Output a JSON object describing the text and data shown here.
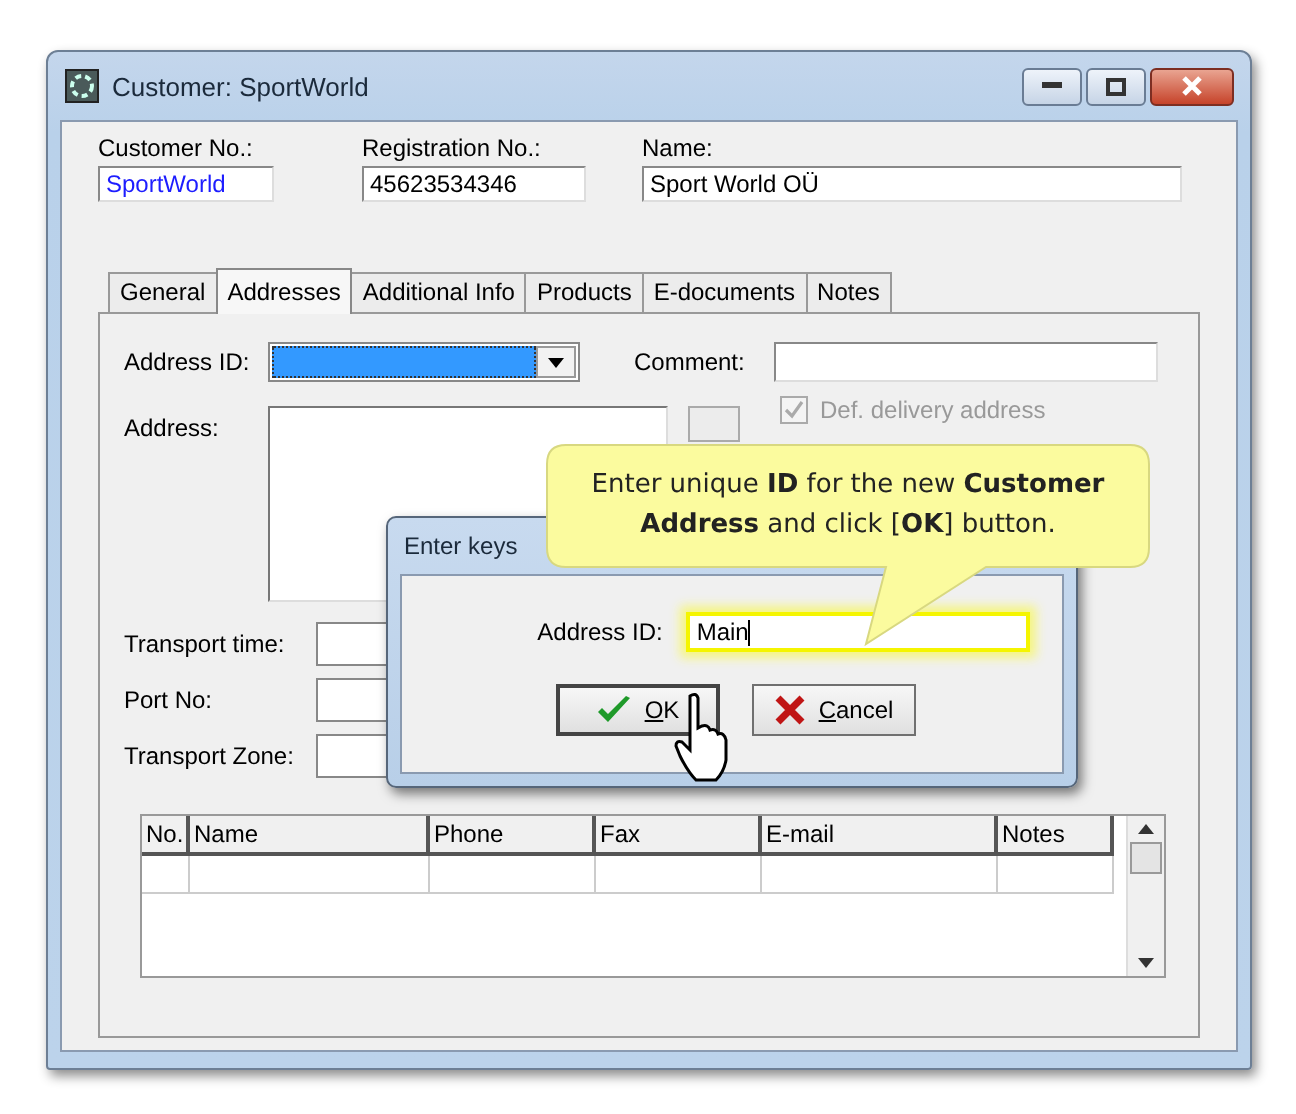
{
  "window": {
    "title": "Customer: SportWorld"
  },
  "header_fields": [
    {
      "label": "Customer No.:",
      "value": "SportWorld",
      "kind": "code"
    },
    {
      "label": "Registration No.:",
      "value": "45623534346",
      "kind": "text"
    },
    {
      "label": "Name:",
      "value": "Sport World OÜ",
      "kind": "text"
    }
  ],
  "tabs": [
    {
      "label": "General",
      "selected": false
    },
    {
      "label": "Addresses",
      "selected": true
    },
    {
      "label": "Additional Info",
      "selected": false
    },
    {
      "label": "Products",
      "selected": false
    },
    {
      "label": "E-documents",
      "selected": false
    },
    {
      "label": "Notes",
      "selected": false
    }
  ],
  "address_tab": {
    "address_id_label": "Address ID:",
    "comment_label": "Comment:",
    "address_label": "Address:",
    "delivery_checkbox": {
      "label": "Def. delivery address",
      "checked": true
    },
    "transport_fields": [
      "Transport time:",
      "Port No:",
      "Transport Zone:"
    ],
    "table": {
      "columns": [
        "No.",
        "Name",
        "Phone",
        "Fax",
        "E-mail",
        "Notes"
      ]
    }
  },
  "dialog": {
    "title": "Enter keys",
    "field_label": "Address ID:",
    "field_value": "Main",
    "buttons": [
      {
        "label": "OK",
        "kind": "ok"
      },
      {
        "label": "Cancel",
        "kind": "cancel"
      }
    ]
  },
  "callout": {
    "text": "Enter unique **ID** for the new **Customer Address** and click [**OK**] button."
  }
}
